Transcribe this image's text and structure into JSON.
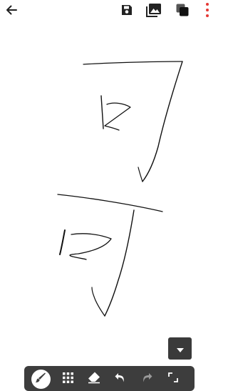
{
  "header": {
    "back_icon": "arrow-back-icon",
    "actions": [
      {
        "name": "save",
        "icon": "save-icon"
      },
      {
        "name": "image",
        "icon": "image-icon"
      },
      {
        "name": "layers",
        "icon": "layers-icon"
      },
      {
        "name": "more",
        "icon": "more-vert-icon",
        "color": "#e53935"
      }
    ]
  },
  "toolbar": {
    "tools": [
      {
        "name": "brush",
        "icon": "brush-icon",
        "active": true
      },
      {
        "name": "grid",
        "icon": "grid-icon",
        "active": false
      },
      {
        "name": "eraser",
        "icon": "eraser-icon",
        "active": false
      },
      {
        "name": "undo",
        "icon": "undo-icon",
        "active": false
      },
      {
        "name": "redo",
        "icon": "redo-icon",
        "active": false
      },
      {
        "name": "crop",
        "icon": "crop-icon",
        "active": false
      }
    ]
  },
  "colors": {
    "toolbar_bg": "#3d3d3d",
    "icon_dark": "#222222",
    "icon_light": "#ffffff",
    "more_icon": "#e53935",
    "stroke": "#111111"
  }
}
